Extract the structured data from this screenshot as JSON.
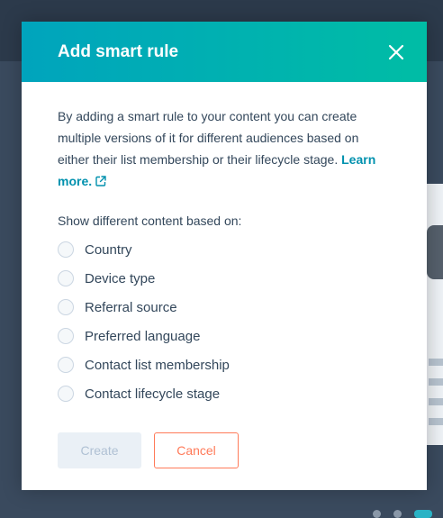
{
  "modal": {
    "title": "Add smart rule",
    "description": "By adding a smart rule to your content you can create multiple versions of it for different audiences based on either their list membership or their lifecycle stage.",
    "learn_more": "Learn more.",
    "section_label": "Show different content based on:",
    "options": [
      {
        "label": "Country",
        "selected": false
      },
      {
        "label": "Device type",
        "selected": false
      },
      {
        "label": "Referral source",
        "selected": false
      },
      {
        "label": "Preferred language",
        "selected": false
      },
      {
        "label": "Contact list membership",
        "selected": false
      },
      {
        "label": "Contact lifecycle stage",
        "selected": false
      }
    ],
    "create_label": "Create",
    "cancel_label": "Cancel",
    "create_enabled": false
  },
  "colors": {
    "header_gradient_start": "#00a4bd",
    "header_gradient_end": "#00bda5",
    "link": "#0091ae",
    "cancel_accent": "#ff7a59",
    "text": "#33475b"
  },
  "icons": {
    "close": "close-icon",
    "external_link": "external-link-icon"
  }
}
